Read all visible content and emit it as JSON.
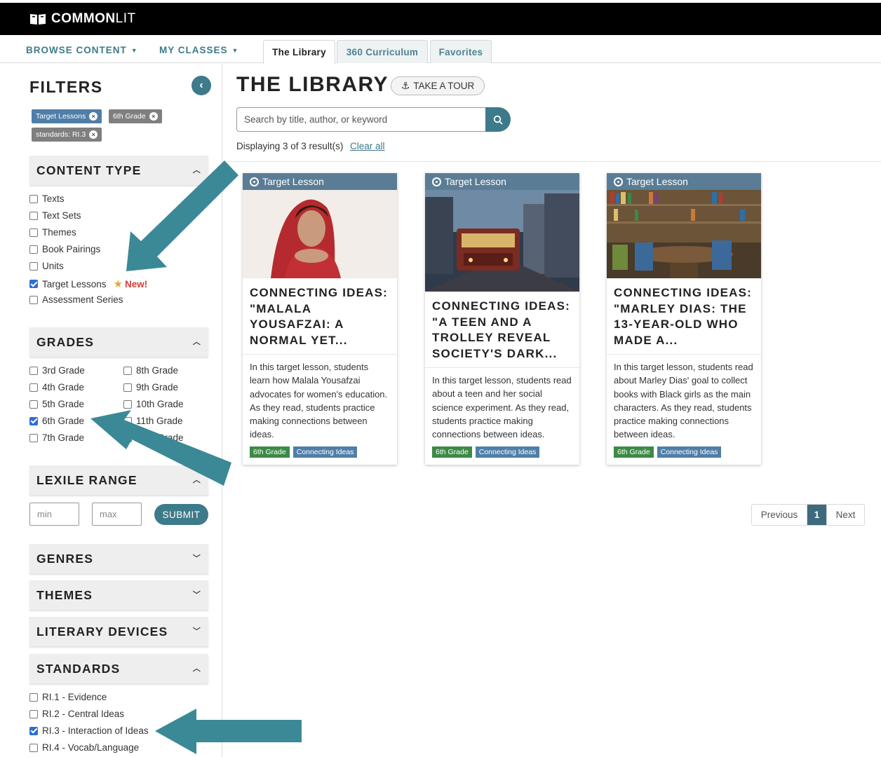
{
  "brand": {
    "name_bold": "COMMON",
    "name_light": "LIT"
  },
  "nav": {
    "browse": "BROWSE CONTENT",
    "classes": "MY CLASSES",
    "tabs": [
      "The Library",
      "360 Curriculum",
      "Favorites"
    ]
  },
  "filters": {
    "title": "FILTERS",
    "chips": [
      "Target Lessons",
      "6th Grade",
      "standards: RI.3"
    ],
    "content_type": {
      "heading": "CONTENT TYPE",
      "items": [
        {
          "label": "Texts",
          "checked": false
        },
        {
          "label": "Text Sets",
          "checked": false
        },
        {
          "label": "Themes",
          "checked": false
        },
        {
          "label": "Book Pairings",
          "checked": false
        },
        {
          "label": "Units",
          "checked": false
        },
        {
          "label": "Target Lessons",
          "checked": true
        },
        {
          "label": "Assessment Series",
          "checked": false
        }
      ],
      "new_label": "New!"
    },
    "grades": {
      "heading": "GRADES",
      "col1": [
        "3rd Grade",
        "4th Grade",
        "5th Grade",
        "6th Grade",
        "7th Grade"
      ],
      "col2": [
        "8th Grade",
        "9th Grade",
        "10th Grade",
        "11th Grade",
        "12th Grade"
      ],
      "checked": "6th Grade"
    },
    "lexile": {
      "heading": "LEXILE RANGE",
      "min_placeholder": "min",
      "max_placeholder": "max",
      "submit": "SUBMIT"
    },
    "genres": "GENRES",
    "themes": "THEMES",
    "literary_devices": "LITERARY DEVICES",
    "standards": {
      "heading": "STANDARDS",
      "items": [
        {
          "label": "RI.1 - Evidence",
          "checked": false
        },
        {
          "label": "RI.2 - Central Ideas",
          "checked": false
        },
        {
          "label": "RI.3 - Interaction of Ideas",
          "checked": true
        },
        {
          "label": "RI.4 - Vocab/Language",
          "checked": false
        }
      ]
    }
  },
  "library": {
    "title": "THE LIBRARY",
    "tour": "TAKE A TOUR",
    "search_placeholder": "Search by title, author, or keyword",
    "count": "Displaying 3 of 3 result(s)",
    "clear": "Clear all"
  },
  "cards": [
    {
      "banner": "Target Lesson",
      "title": "CONNECTING IDEAS: \"MALALA YOUSAFZAI: A NORMAL YET...",
      "desc": "In this target lesson, students learn how Malala Yousafzai advocates for women's education. As they read, students practice making connections between ideas.",
      "tags": [
        "6th Grade",
        "Connecting Ideas"
      ]
    },
    {
      "banner": "Target Lesson",
      "title": "CONNECTING IDEAS: \"A TEEN AND A TROLLEY REVEAL SOCIETY'S DARK...",
      "desc": "In this target lesson, students read about a teen and her social science experiment. As they read, students practice making connections between ideas.",
      "tags": [
        "6th Grade",
        "Connecting Ideas"
      ]
    },
    {
      "banner": "Target Lesson",
      "title": "CONNECTING IDEAS: \"MARLEY DIAS: THE 13-YEAR-OLD WHO MADE A...",
      "desc": "In this target lesson, students read about Marley Dias' goal to collect books with Black girls as the main characters. As they read, students practice making connections between ideas.",
      "tags": [
        "6th Grade",
        "Connecting Ideas"
      ]
    }
  ],
  "pager": {
    "prev": "Previous",
    "current": "1",
    "next": "Next"
  },
  "colors": {
    "teal": "#3d7a8a",
    "banner": "#5a7d95",
    "arrow": "#3b8996"
  }
}
